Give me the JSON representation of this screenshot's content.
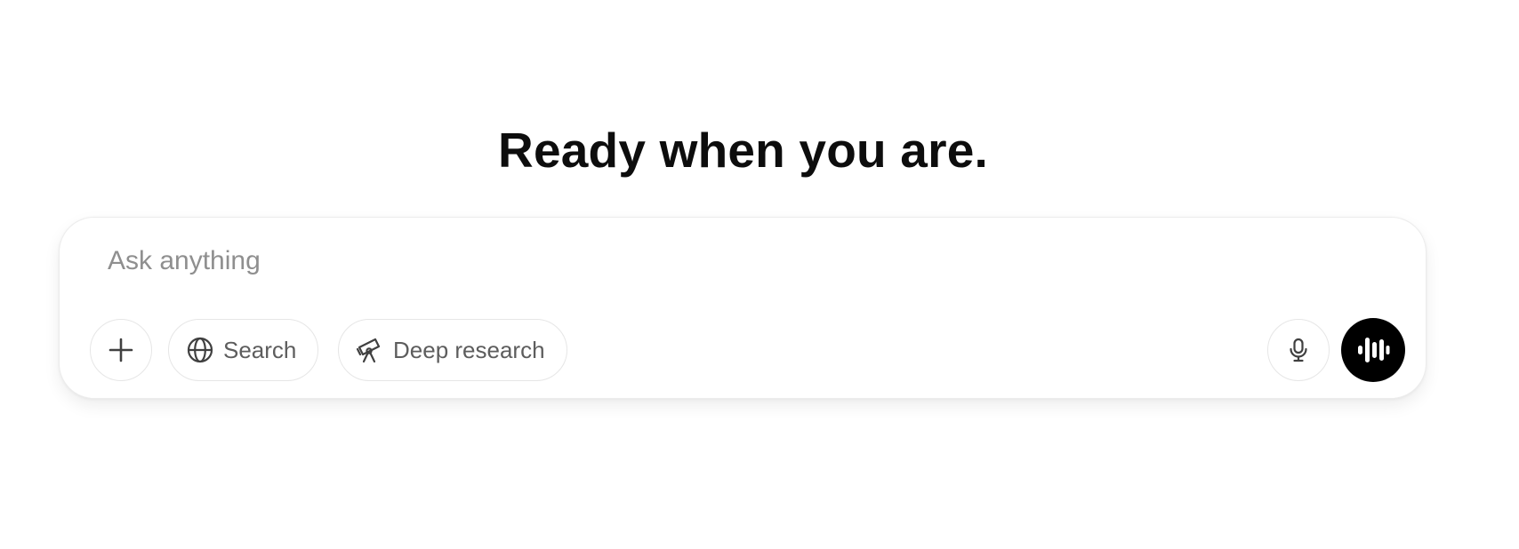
{
  "heading": "Ready when you are.",
  "composer": {
    "placeholder": "Ask anything",
    "value": ""
  },
  "toolbar": {
    "add_icon": "plus-icon",
    "search": {
      "label": "Search",
      "icon": "globe-icon"
    },
    "deep_research": {
      "label": "Deep research",
      "icon": "telescope-icon"
    },
    "mic_icon": "microphone-icon",
    "voice_icon": "voice-waveform-icon"
  },
  "colors": {
    "heading": "#0d0d0d",
    "placeholder": "#8f8f8f",
    "button_text": "#5d5d5d",
    "button_border": "#e6e6e6",
    "voice_button_bg": "#000000",
    "voice_button_icon": "#ffffff"
  }
}
